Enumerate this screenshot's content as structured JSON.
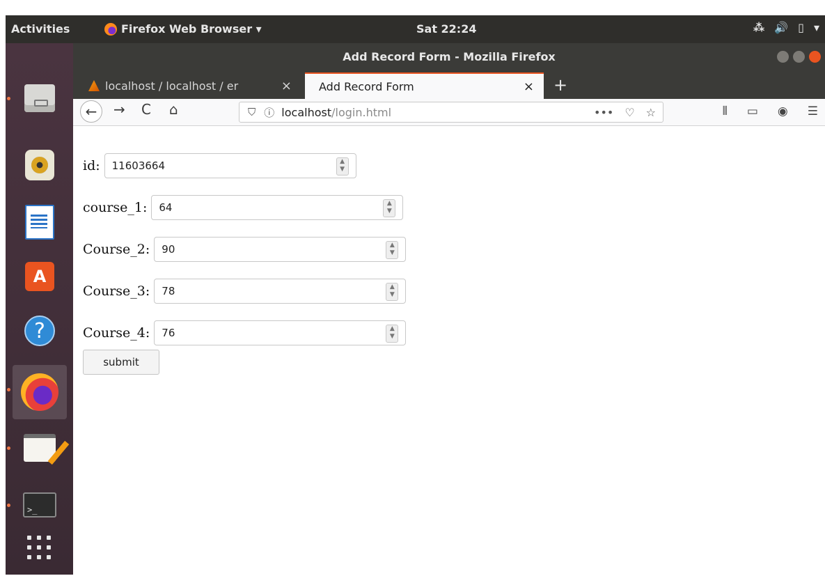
{
  "top_panel": {
    "activities": "Activities",
    "app_menu": "Firefox Web Browser ▾",
    "clock": "Sat 22:24",
    "tray_icons": [
      "network-icon",
      "volume-icon",
      "battery-icon",
      "system-menu-icon"
    ]
  },
  "dock": {
    "items": [
      "files-icon",
      "rhythmbox-icon",
      "libreoffice-writer-icon",
      "software-center-icon",
      "help-icon",
      "firefox-icon",
      "text-editor-icon",
      "terminal-icon",
      "show-apps-icon"
    ]
  },
  "window": {
    "title": "Add Record Form - Mozilla Firefox",
    "tabs": [
      {
        "label": "localhost / localhost / er",
        "close": "×"
      },
      {
        "label": "Add Record Form",
        "close": "×"
      }
    ],
    "new_tab": "+",
    "nav": {
      "back": "←",
      "forward": "→",
      "reload": "C",
      "home": "⌂"
    },
    "url": {
      "host": "localhost",
      "path": "/login.html",
      "actions": [
        "•••",
        "pocket-icon",
        "☆"
      ]
    },
    "toolbar_icons": [
      "library-icon",
      "sidebar-icon",
      "account-icon",
      "menu-icon"
    ]
  },
  "form": {
    "fields": [
      {
        "label": "id:",
        "value": "11603664"
      },
      {
        "label": "course_1:",
        "value": "64"
      },
      {
        "label": "Course_2:",
        "value": "90"
      },
      {
        "label": "Course_3:",
        "value": "78"
      },
      {
        "label": "Course_4:",
        "value": "76"
      }
    ],
    "submit": "submit"
  },
  "colors": {
    "ubuntu_orange": "#E95420",
    "panel": "#2F2E2B",
    "titlebar": "#3B3B38"
  }
}
